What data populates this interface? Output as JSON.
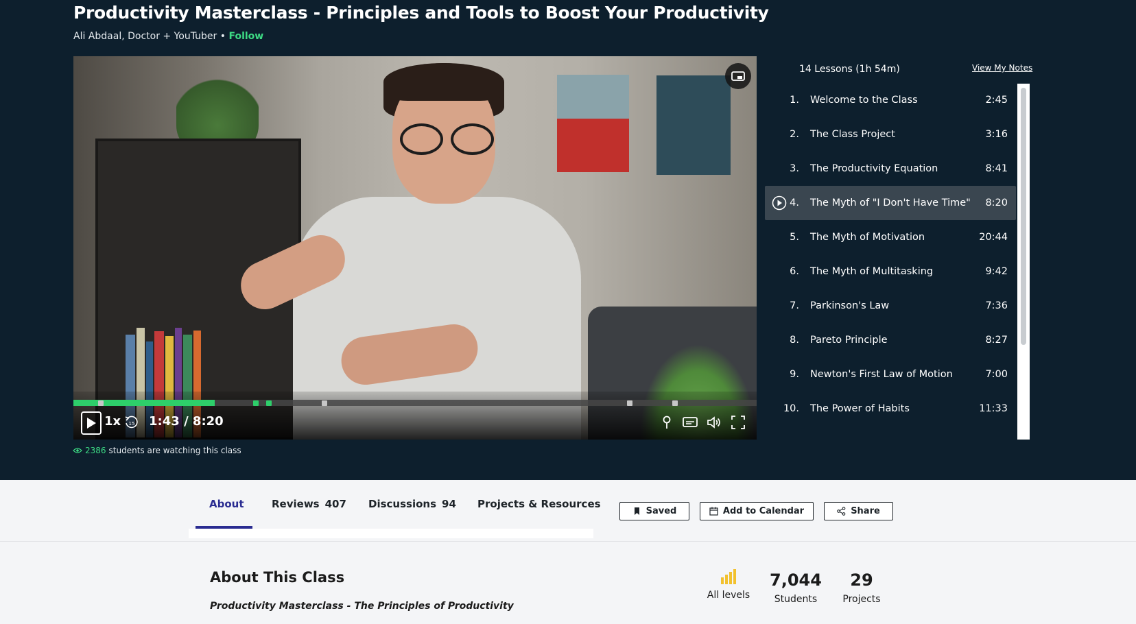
{
  "course": {
    "title": "Productivity Masterclass - Principles and Tools to Boost Your Productivity",
    "author": "Ali Abdaal, Doctor + YouTuber",
    "separator": "•",
    "follow_label": "Follow"
  },
  "player": {
    "speed": "1x",
    "current_time": "1:43",
    "duration": "8:20",
    "time_separator": "/",
    "progress_fraction": 0.207,
    "rewind_seconds": "15",
    "icons": [
      "play-icon",
      "rewind-15-icon",
      "notes-pin-icon",
      "captions-icon",
      "volume-icon",
      "fullscreen-icon",
      "picture-in-picture-icon"
    ]
  },
  "watching": {
    "count": "2386",
    "text": "students are watching this class"
  },
  "lessons": {
    "header": "14 Lessons (1h 54m)",
    "view_notes": "View My Notes",
    "items": [
      {
        "num": "1.",
        "title": "Welcome to the Class",
        "duration": "2:45"
      },
      {
        "num": "2.",
        "title": "The Class Project",
        "duration": "3:16"
      },
      {
        "num": "3.",
        "title": "The Productivity Equation",
        "duration": "8:41"
      },
      {
        "num": "4.",
        "title": "The Myth of \"I Don't Have Time\"",
        "duration": "8:20"
      },
      {
        "num": "5.",
        "title": "The Myth of Motivation",
        "duration": "20:44"
      },
      {
        "num": "6.",
        "title": "The Myth of Multitasking",
        "duration": "9:42"
      },
      {
        "num": "7.",
        "title": "Parkinson's Law",
        "duration": "7:36"
      },
      {
        "num": "8.",
        "title": "Pareto Principle",
        "duration": "8:27"
      },
      {
        "num": "9.",
        "title": "Newton's First Law of Motion",
        "duration": "7:00"
      },
      {
        "num": "10.",
        "title": "The Power of Habits",
        "duration": "11:33"
      }
    ]
  },
  "tabs": {
    "about": "About",
    "reviews": "Reviews",
    "reviews_count": "407",
    "discussions": "Discussions",
    "discussions_count": "94",
    "projects": "Projects & Resources"
  },
  "actions": {
    "saved": "Saved",
    "calendar": "Add to Calendar",
    "share": "Share"
  },
  "about": {
    "title": "About This Class",
    "subtitle": "Productivity Masterclass - The Principles of Productivity"
  },
  "stats": {
    "level": "All levels",
    "students_value": "7,044",
    "students_label": "Students",
    "projects_value": "29",
    "projects_label": "Projects"
  },
  "colors": {
    "header_bg": "#0d1f2d",
    "accent_green": "#3ddb84",
    "progress_green": "#2ecf6a",
    "tab_active": "#2a2c91",
    "level_yellow": "#f2c12e"
  }
}
